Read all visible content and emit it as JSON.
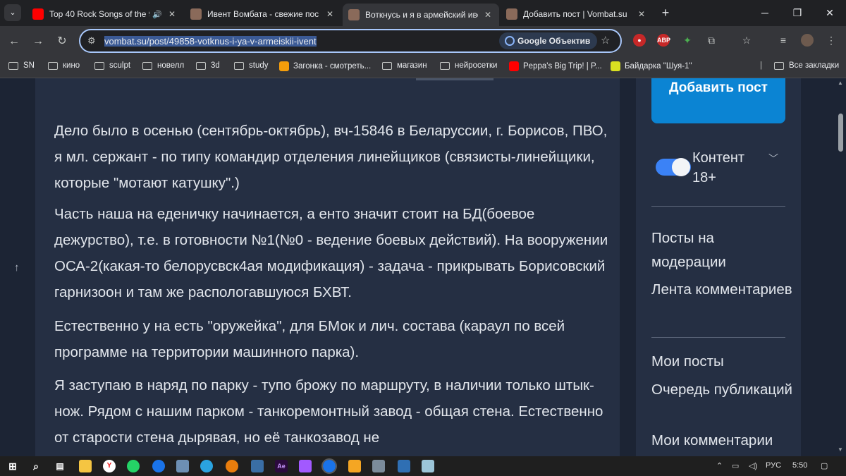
{
  "browser": {
    "tabs": [
      {
        "title": "Top 40 Rock Songs of the 9",
        "color": "#ff0000",
        "audio": true
      },
      {
        "title": "Ивент Вомбата - свежие пос",
        "color": "#8a6a5a"
      },
      {
        "title": "Воткнусь и я в армейский иве",
        "color": "#8a6a5a",
        "active": true
      },
      {
        "title": "Добавить пост | Vombat.su",
        "color": "#8a6a5a"
      }
    ],
    "url": "vombat.su/post/49858-votknus-i-ya-v-armeiskii-ivent",
    "lens_label": "Google Объектив",
    "bookmarks": [
      {
        "label": "SN",
        "type": "folder"
      },
      {
        "label": "кино",
        "type": "folder"
      },
      {
        "label": "sculpt",
        "type": "folder"
      },
      {
        "label": "новелл",
        "type": "folder"
      },
      {
        "label": "3d",
        "type": "folder"
      },
      {
        "label": "study",
        "type": "folder"
      },
      {
        "label": "Загонка - смотреть...",
        "type": "site",
        "color": "#f59e0b"
      },
      {
        "label": "магазин",
        "type": "folder"
      },
      {
        "label": "нейросетки",
        "type": "folder"
      },
      {
        "label": "Peppa's Big Trip! | P...",
        "type": "site",
        "color": "#ff0000"
      },
      {
        "label": "Байдарка \"Шуя-1\"",
        "type": "site",
        "color": "#d9e021"
      }
    ],
    "all_bookmarks": "Все закладки",
    "ext_abp": "ABP"
  },
  "article": {
    "paragraphs": [
      "Дело было в осенью (сентябрь-октябрь), вч-15846 в Беларуссии, г. Борисов, ПВО, я мл. сержант - по типу командир отделения линейщиков (связисты-линейщики, которые \"мотают катушку\".)",
      "Часть наша на еденичку начинается, а енто значит стоит на БД(боевое дежурство), т.е. в готовности №1(№0 - ведение боевых действий). На вооружении ОСА-2(какая-то белорусвск4ая модификация) - задача - прикрывать Борисовский гарнизоон и там же распологавшуюся БХВТ.",
      "Естественно у на есть \"оружейка\", для БМок и лич. состава (караул по всей программе на территории машинного парка).",
      "Я заступаю в наряд по парку - тупо брожу по маршруту, в наличии только штык-нож. Рядом с нашим парком - танкоремонтный завод - общая стена. Естественно от старости стена дырявая, но её танкозавод не"
    ]
  },
  "sidebar": {
    "add_post": "Добавить пост",
    "adult_label": "Контент 18+",
    "adult_enabled": true,
    "links_group1": [
      "Посты на модерации",
      "Лента комментариев"
    ],
    "links_group2": [
      "Мои посты",
      "Очередь публикаций",
      "Мои комментарии"
    ]
  },
  "taskbar": {
    "lang": "РУС",
    "time": "5:50"
  }
}
